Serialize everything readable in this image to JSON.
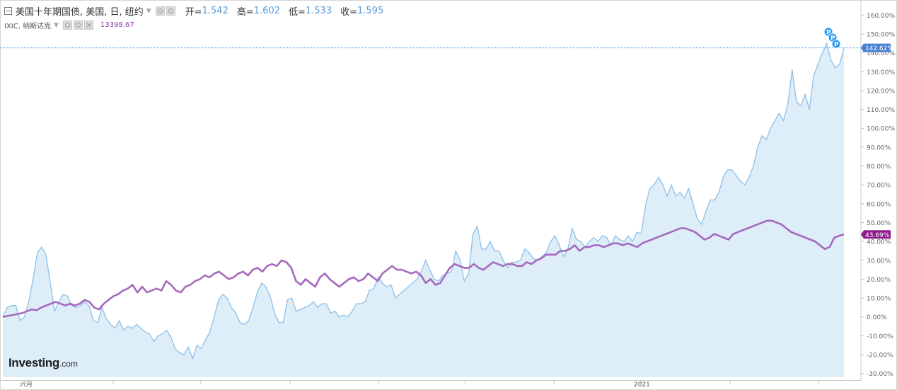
{
  "legend": {
    "main_title": "美国十年期国债, 美国, 日, 纽约",
    "ohlc": [
      {
        "label": "开=",
        "value": "1.542"
      },
      {
        "label": "高=",
        "value": "1.602"
      },
      {
        "label": "低=",
        "value": "1.533"
      },
      {
        "label": "收=",
        "value": "1.595"
      }
    ],
    "compare_title": "IXIC, 纳斯达克",
    "compare_value": "13398.67"
  },
  "logo": {
    "brand": "Investing",
    "suffix": ".com"
  },
  "colors": {
    "main_line": "#8ebfe8",
    "main_fill": "#ddeef9",
    "compare_line": "#a569bd",
    "compare_line_dark": "#9b3fb0",
    "label_main_bg": "#4a7fd6",
    "label_compare_bg": "#8e1a8e",
    "marker": "#2196f3"
  },
  "chart_data": {
    "type": "area",
    "ylim": [
      -32,
      165
    ],
    "y_unit": "%",
    "y_ticks": [
      "160.00%",
      "150.00%",
      "140.00%",
      "130.00%",
      "120.00%",
      "110.00%",
      "100.00%",
      "90.00%",
      "80.00%",
      "70.00%",
      "60.00%",
      "50.00%",
      "40.00%",
      "30.00%",
      "20.00%",
      "10.00%",
      "0.00%",
      "-10.00%",
      "-20.00%",
      "-30.00%"
    ],
    "x_tick_labels": [
      "六月",
      "2021"
    ],
    "grid": false,
    "markers": [
      "P",
      "P",
      "P"
    ],
    "series": [
      {
        "name": "美国十年期国债",
        "style": "area",
        "last_label": "142.62%",
        "values": [
          0,
          5,
          6,
          6,
          -2,
          0,
          8,
          20,
          34,
          37,
          33,
          18,
          3,
          8,
          12,
          11,
          6,
          5,
          6,
          8,
          6,
          -2,
          -3,
          5,
          -1,
          -4,
          -6,
          -2,
          -7,
          -5,
          -6,
          -4,
          -6,
          -8,
          -9,
          -13,
          -10,
          -9,
          -7,
          -11,
          -17,
          -19,
          -20,
          -16,
          -22,
          -15,
          -17,
          -12,
          -8,
          0,
          9,
          12,
          10,
          5,
          2,
          -3,
          -4,
          -2,
          5,
          13,
          18,
          16,
          11,
          2,
          -3,
          -3,
          9,
          10,
          3,
          4,
          5,
          6,
          8,
          5,
          7,
          7,
          2,
          3,
          0,
          1,
          0,
          3,
          7,
          7,
          8,
          14,
          15,
          21,
          18,
          16,
          17,
          10,
          12,
          14,
          16,
          18,
          20,
          24,
          30,
          25,
          20,
          19,
          22,
          23,
          24,
          35,
          30,
          19,
          23,
          44,
          48,
          36,
          36,
          40,
          35,
          35,
          30,
          26,
          29,
          29,
          30,
          36,
          34,
          31,
          30,
          32,
          34,
          40,
          43,
          38,
          32,
          36,
          47,
          41,
          40,
          37,
          40,
          42,
          40,
          43,
          42,
          38,
          43,
          41,
          40,
          43,
          40,
          45,
          44,
          59,
          68,
          70,
          74,
          70,
          64,
          70,
          64,
          66,
          63,
          68,
          60,
          52,
          49,
          56,
          62,
          62,
          66,
          74,
          78,
          78,
          75,
          72,
          70,
          74,
          80,
          90,
          96,
          94,
          100,
          104,
          108,
          104,
          113,
          131,
          114,
          112,
          118,
          110,
          128,
          134,
          140,
          145,
          136,
          132,
          134,
          142.62
        ]
      },
      {
        "name": "IXIC",
        "style": "line",
        "last_label": "43.69%",
        "values": [
          0,
          0.5,
          1,
          1.5,
          2,
          3,
          4,
          3.5,
          5,
          6,
          7,
          8,
          7,
          6,
          7,
          6,
          7,
          9,
          8,
          5,
          4,
          7,
          9,
          11,
          12,
          14,
          15,
          17,
          13,
          16,
          13,
          14,
          15,
          14,
          19,
          17,
          14,
          13,
          16,
          17,
          19,
          20,
          22,
          21,
          23,
          24,
          22,
          20,
          21,
          23,
          24,
          22,
          25,
          26,
          24,
          27,
          28,
          27,
          30,
          29,
          26,
          19,
          17,
          20,
          18,
          16,
          21,
          23,
          20,
          18,
          16,
          18,
          20,
          21,
          19,
          20,
          23,
          21,
          19,
          23,
          25,
          27,
          25,
          25,
          24,
          23,
          24,
          22,
          18,
          20,
          17,
          18,
          22,
          26,
          28,
          27,
          26,
          26,
          28,
          26,
          25,
          27,
          29,
          28,
          27,
          28,
          28,
          27,
          27,
          29,
          28,
          30,
          31,
          33,
          33,
          33,
          35,
          35,
          36,
          38,
          35,
          37,
          37,
          38,
          38,
          37,
          38,
          39,
          39,
          38,
          39,
          38,
          37,
          39,
          40,
          41,
          42,
          43,
          44,
          45,
          46,
          47,
          47,
          46,
          45,
          43,
          41,
          42,
          44,
          43,
          42,
          41,
          44,
          45,
          46,
          47,
          48,
          49,
          50,
          51,
          51,
          50,
          49,
          47,
          45,
          44,
          43,
          42,
          41,
          40,
          38,
          36,
          37,
          42,
          43,
          43.69
        ]
      }
    ]
  }
}
